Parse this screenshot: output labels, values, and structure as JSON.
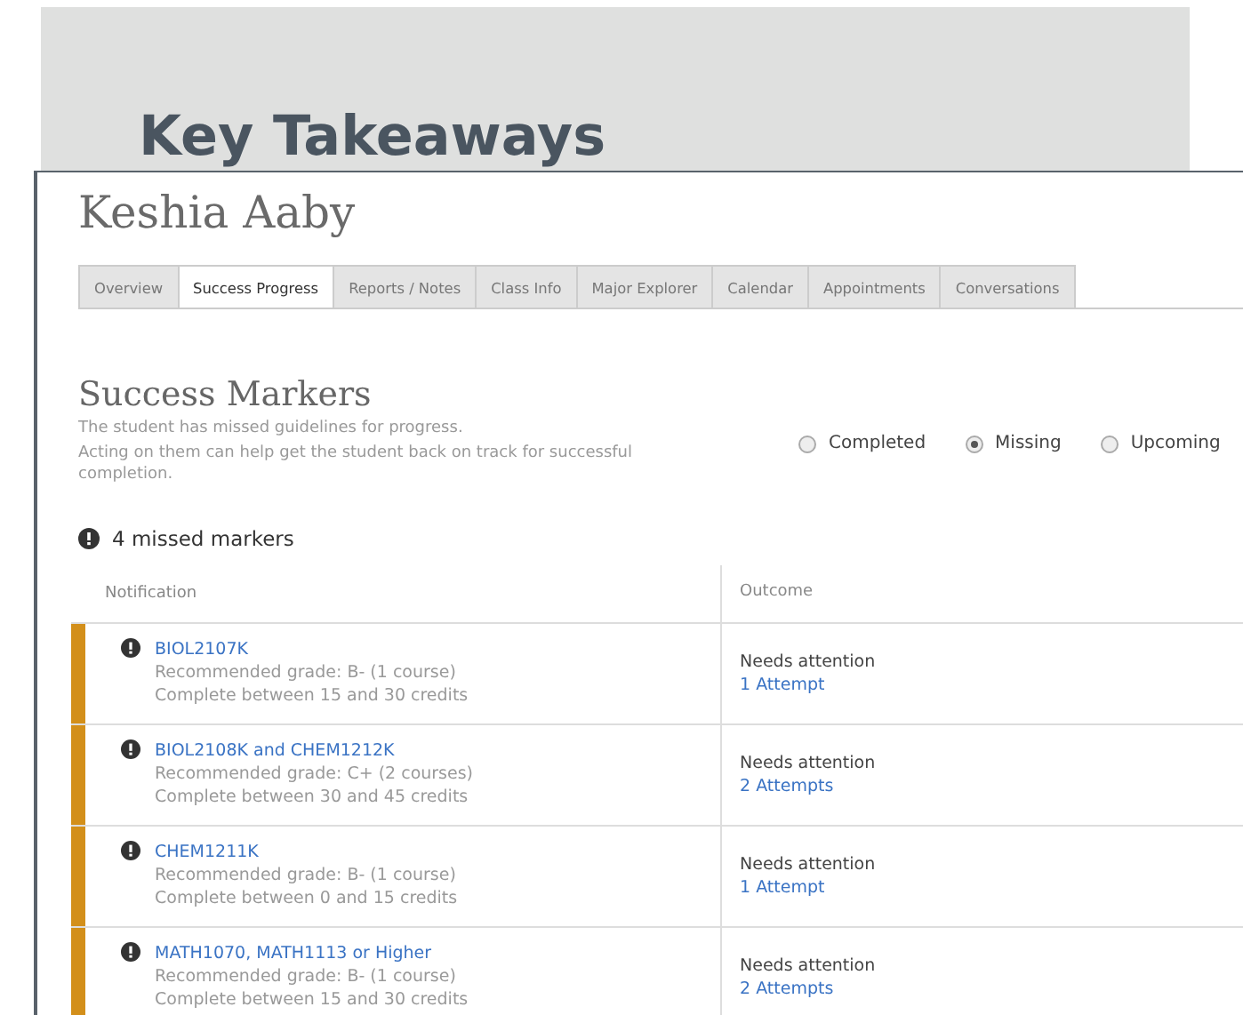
{
  "background": {
    "heading": "Key Takeaways"
  },
  "student": {
    "name": "Keshia Aaby"
  },
  "tabs": [
    {
      "label": "Overview",
      "selected": false
    },
    {
      "label": "Success Progress",
      "selected": true
    },
    {
      "label": "Reports / Notes",
      "selected": false
    },
    {
      "label": "Class Info",
      "selected": false
    },
    {
      "label": "Major Explorer",
      "selected": false
    },
    {
      "label": "Calendar",
      "selected": false
    },
    {
      "label": "Appointments",
      "selected": false
    },
    {
      "label": "Conversations",
      "selected": false
    }
  ],
  "section": {
    "title": "Success Markers",
    "description": [
      "The student has missed guidelines for progress.",
      "Acting on them can help get the student back on track for successful completion."
    ]
  },
  "filters": [
    {
      "label": "Completed",
      "selected": false
    },
    {
      "label": "Missing",
      "selected": true
    },
    {
      "label": "Upcoming",
      "selected": false
    }
  ],
  "summary": "4 missed markers",
  "table": {
    "columns": [
      "Notification",
      "Outcome"
    ],
    "rows": [
      {
        "course": "BIOL2107K",
        "grade": "Recommended grade: B- (1 course)",
        "credits": "Complete between 15 and 30 credits",
        "status": "Needs attention",
        "attempts": "1 Attempt",
        "color": "#d38f1a"
      },
      {
        "course": "BIOL2108K and CHEM1212K",
        "grade": "Recommended grade: C+ (2 courses)",
        "credits": "Complete between 30 and 45 credits",
        "status": "Needs attention",
        "attempts": "2 Attempts",
        "color": "#d38f1a"
      },
      {
        "course": "CHEM1211K",
        "grade": "Recommended grade: B- (1 course)",
        "credits": "Complete between 0 and 15 credits",
        "status": "Needs attention",
        "attempts": "1 Attempt",
        "color": "#d38f1a"
      },
      {
        "course": "MATH1070, MATH1113 or Higher",
        "grade": "Recommended grade: B- (1 course)",
        "credits": "Complete between 15 and 30 credits",
        "status": "Needs attention",
        "attempts": "2 Attempts",
        "color": "#d38f1a"
      }
    ]
  }
}
